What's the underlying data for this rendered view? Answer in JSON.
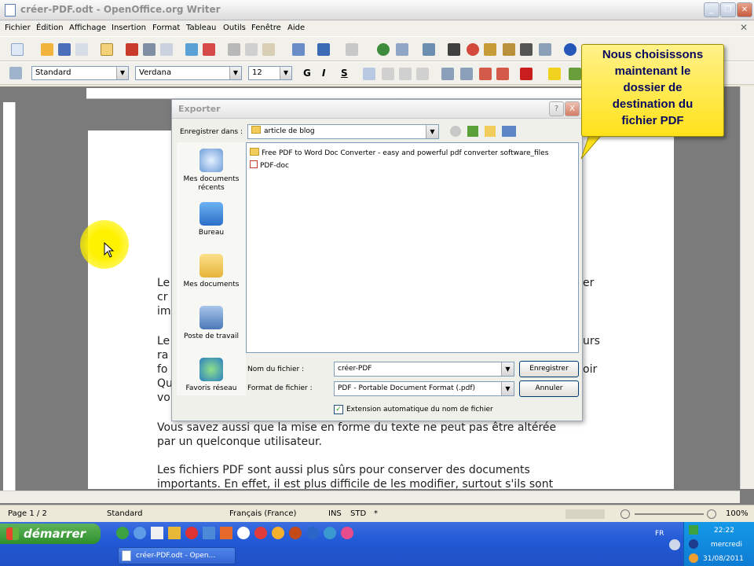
{
  "window": {
    "title": "créer-PDF.odt - OpenOffice.org Writer"
  },
  "menu": [
    "Fichier",
    "Édition",
    "Affichage",
    "Insertion",
    "Format",
    "Tableau",
    "Outils",
    "Fenêtre",
    "Aide"
  ],
  "formatting": {
    "style": "Standard",
    "font": "Verdana",
    "size": "12",
    "bold": "G",
    "italic": "I",
    "underline": "S"
  },
  "document": {
    "lines": [
      {
        "text": "Le",
        "tail": "er"
      },
      {
        "text": "cr",
        "tail": ""
      },
      {
        "text": "im",
        "tail": ""
      },
      {
        "text": "Le",
        "tail": "urs"
      },
      {
        "text": "ra",
        "tail": ""
      },
      {
        "text": "fo",
        "tail": "oir"
      },
      {
        "text": "Qu",
        "tail": ""
      },
      {
        "text": "vo",
        "tail": ""
      }
    ],
    "paragraph2_line1": "Vous savez aussi que la mise en forme du texte ne peut pas être altérée",
    "paragraph2_line2": "par un quelconque utilisateur.",
    "paragraph3_line1": "Les fichiers PDF sont aussi plus sûrs pour conserver des documents",
    "paragraph3_line2": "importants. En effet, il est plus difficile de les modifier, surtout s'ils sont"
  },
  "dialog": {
    "title": "Exporter",
    "help": "?",
    "close": "X",
    "save_in_label": "Enregistrer dans :",
    "save_in_value": "article de blog",
    "places": [
      "Mes documents récents",
      "Bureau",
      "Mes documents",
      "Poste de travail",
      "Favoris réseau"
    ],
    "files": [
      {
        "name": "Free PDF to Word Doc Converter - easy and powerful pdf converter software_files",
        "type": "folder"
      },
      {
        "name": "PDF-doc",
        "type": "pdf"
      }
    ],
    "filename_label": "Nom du fichier :",
    "filename_value": "créer-PDF",
    "format_label": "Format de fichier :",
    "format_value": "PDF - Portable Document Format (.pdf)",
    "save_button": "Enregistrer",
    "cancel_button": "Annuler",
    "auto_ext_label": "Extension automatique du nom de fichier",
    "auto_ext_checked": true
  },
  "callout": {
    "lines": [
      "Nous choisissons",
      "maintenant le",
      "dossier de",
      "destination du",
      "fichier PDF"
    ]
  },
  "status": {
    "page": "Page 1 / 2",
    "style": "Standard",
    "language": "Français (France)",
    "ins": "INS",
    "std": "STD",
    "mod": "*",
    "zoom": "100%"
  },
  "taskbar": {
    "start": "démarrer",
    "task": "créer-PDF.odt - Open...",
    "lang": "FR",
    "time": "22:22",
    "day": "mercredi",
    "date": "31/08/2011"
  }
}
